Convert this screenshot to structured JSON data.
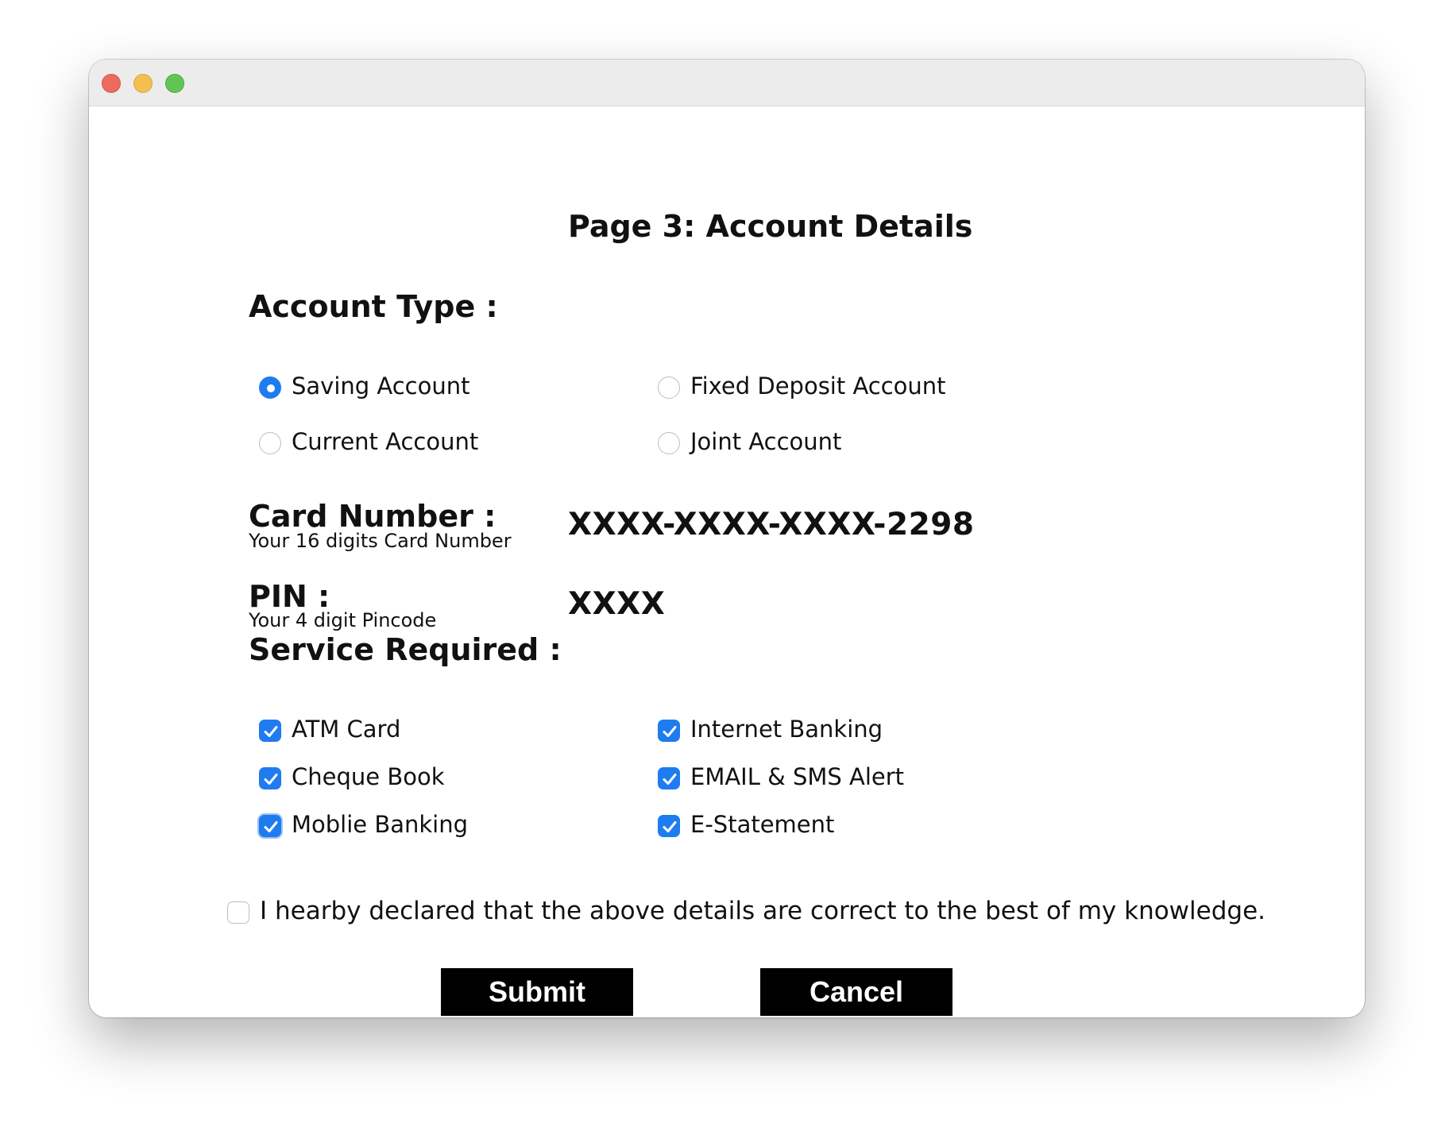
{
  "window": {
    "controls": [
      "close",
      "minimize",
      "maximize"
    ]
  },
  "page": {
    "title": "Page 3: Account Details"
  },
  "account_type": {
    "heading": "Account Type :",
    "options": [
      {
        "label": "Saving Account",
        "selected": true
      },
      {
        "label": "Fixed Deposit Account",
        "selected": false
      },
      {
        "label": "Current Account",
        "selected": false
      },
      {
        "label": "Joint Account",
        "selected": false
      }
    ]
  },
  "card": {
    "heading": "Card Number :",
    "hint": "Your 16 digits Card Number",
    "value": "XXXX-XXXX-XXXX-2298"
  },
  "pin": {
    "heading": "PIN :",
    "hint": "Your 4 digit Pincode",
    "value": "XXXX"
  },
  "services": {
    "heading": "Service Required :",
    "items": [
      {
        "label": "ATM Card",
        "checked": true
      },
      {
        "label": "Internet Banking",
        "checked": true
      },
      {
        "label": "Cheque Book",
        "checked": true
      },
      {
        "label": "EMAIL & SMS Alert",
        "checked": true
      },
      {
        "label": "Moblie Banking",
        "checked": true
      },
      {
        "label": "E-Statement",
        "checked": true
      }
    ]
  },
  "declaration": {
    "text": "I hearby declared that the above details are correct to the best of my knowledge.",
    "checked": false
  },
  "buttons": {
    "submit": "Submit",
    "cancel": "Cancel"
  },
  "colors": {
    "accent": "#1e7cf0",
    "button_bg": "#000000",
    "button_text": "#ffffff"
  }
}
